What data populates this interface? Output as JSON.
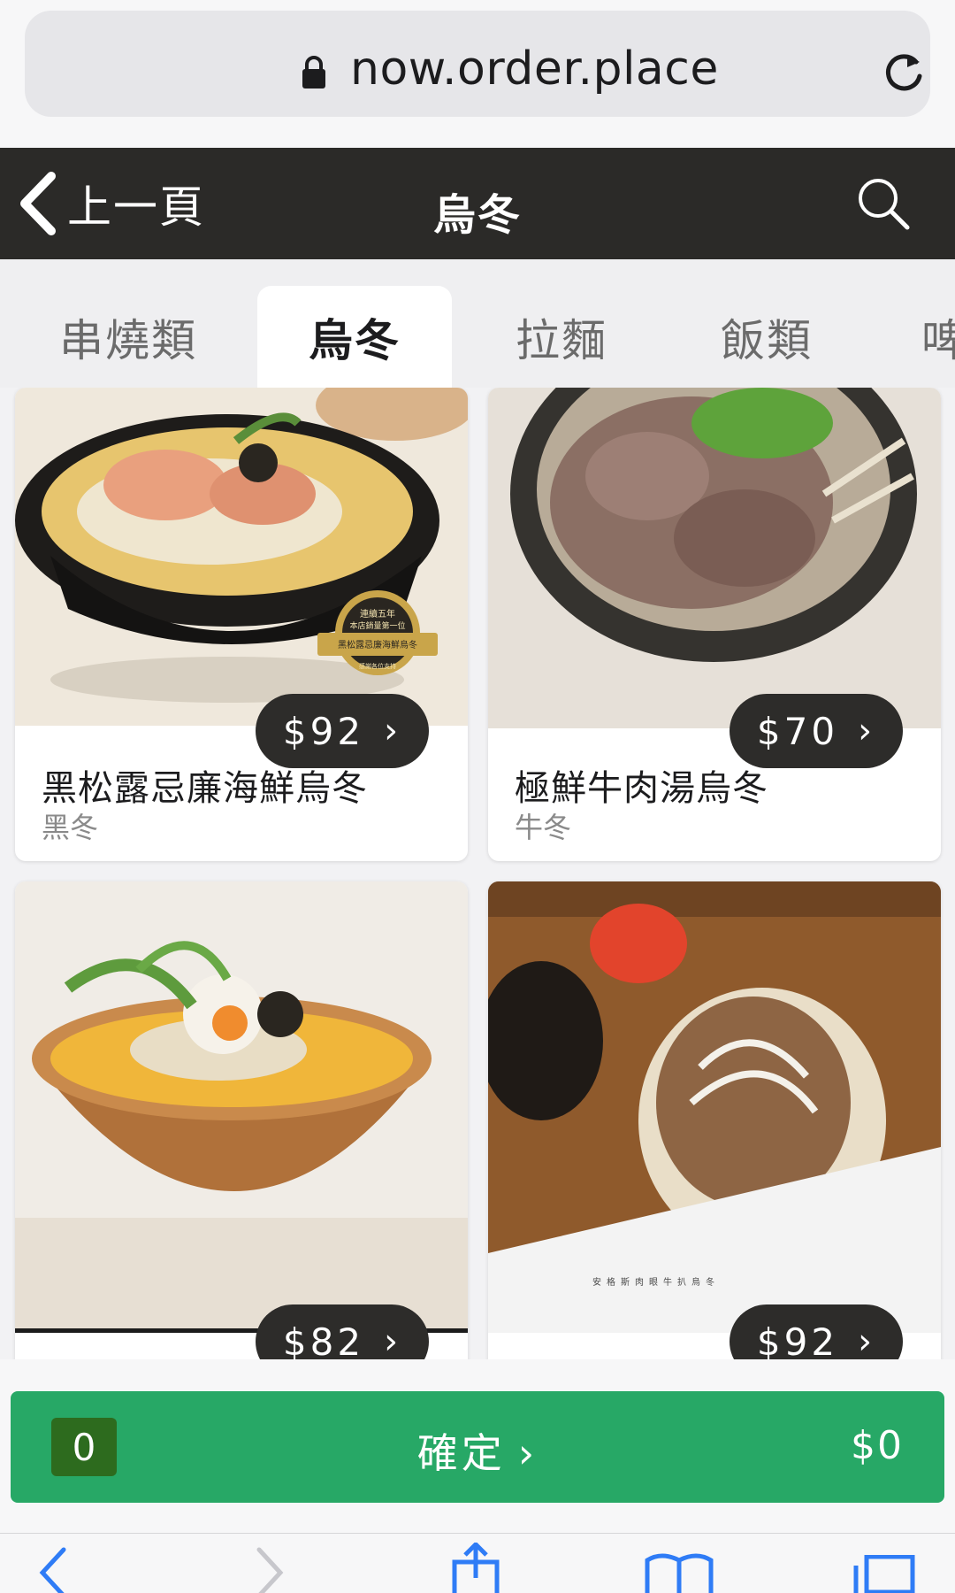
{
  "browser": {
    "url": "now.order.place",
    "icons": [
      "lock-icon",
      "reload-icon"
    ]
  },
  "header": {
    "back_label": "上一頁",
    "title": "烏冬",
    "icons": [
      "chevron-left-icon",
      "search-icon"
    ]
  },
  "tabs": [
    {
      "label": "串燒類",
      "active": false
    },
    {
      "label": "烏冬",
      "active": true
    },
    {
      "label": "拉麵",
      "active": false
    },
    {
      "label": "飯類",
      "active": false
    },
    {
      "label": "啤",
      "active": false
    }
  ],
  "items": [
    {
      "price": "$92",
      "name": "黑松露忌廉海鮮烏冬",
      "subtitle": "黑冬",
      "badge": {
        "line1": "連續五年",
        "line2": "本店銷量第一位",
        "line3": "黑松露忌廉海鮮烏冬",
        "line4": "感謝各位支持"
      }
    },
    {
      "price": "$70",
      "name": "極鮮牛肉湯烏冬",
      "subtitle": "牛冬"
    },
    {
      "price": "$82",
      "name": "",
      "subtitle": ""
    },
    {
      "price": "$92",
      "name": "",
      "subtitle": "",
      "caption": "安格斯肉眼牛扒烏冬"
    }
  ],
  "footer": {
    "count": "0",
    "confirm_label": "確定",
    "total": "$0",
    "accent": "#27a866"
  },
  "toolbar": {
    "icons": [
      "back-arrow-icon",
      "forward-arrow-icon",
      "share-icon",
      "bookmarks-icon",
      "tabs-icon"
    ]
  }
}
